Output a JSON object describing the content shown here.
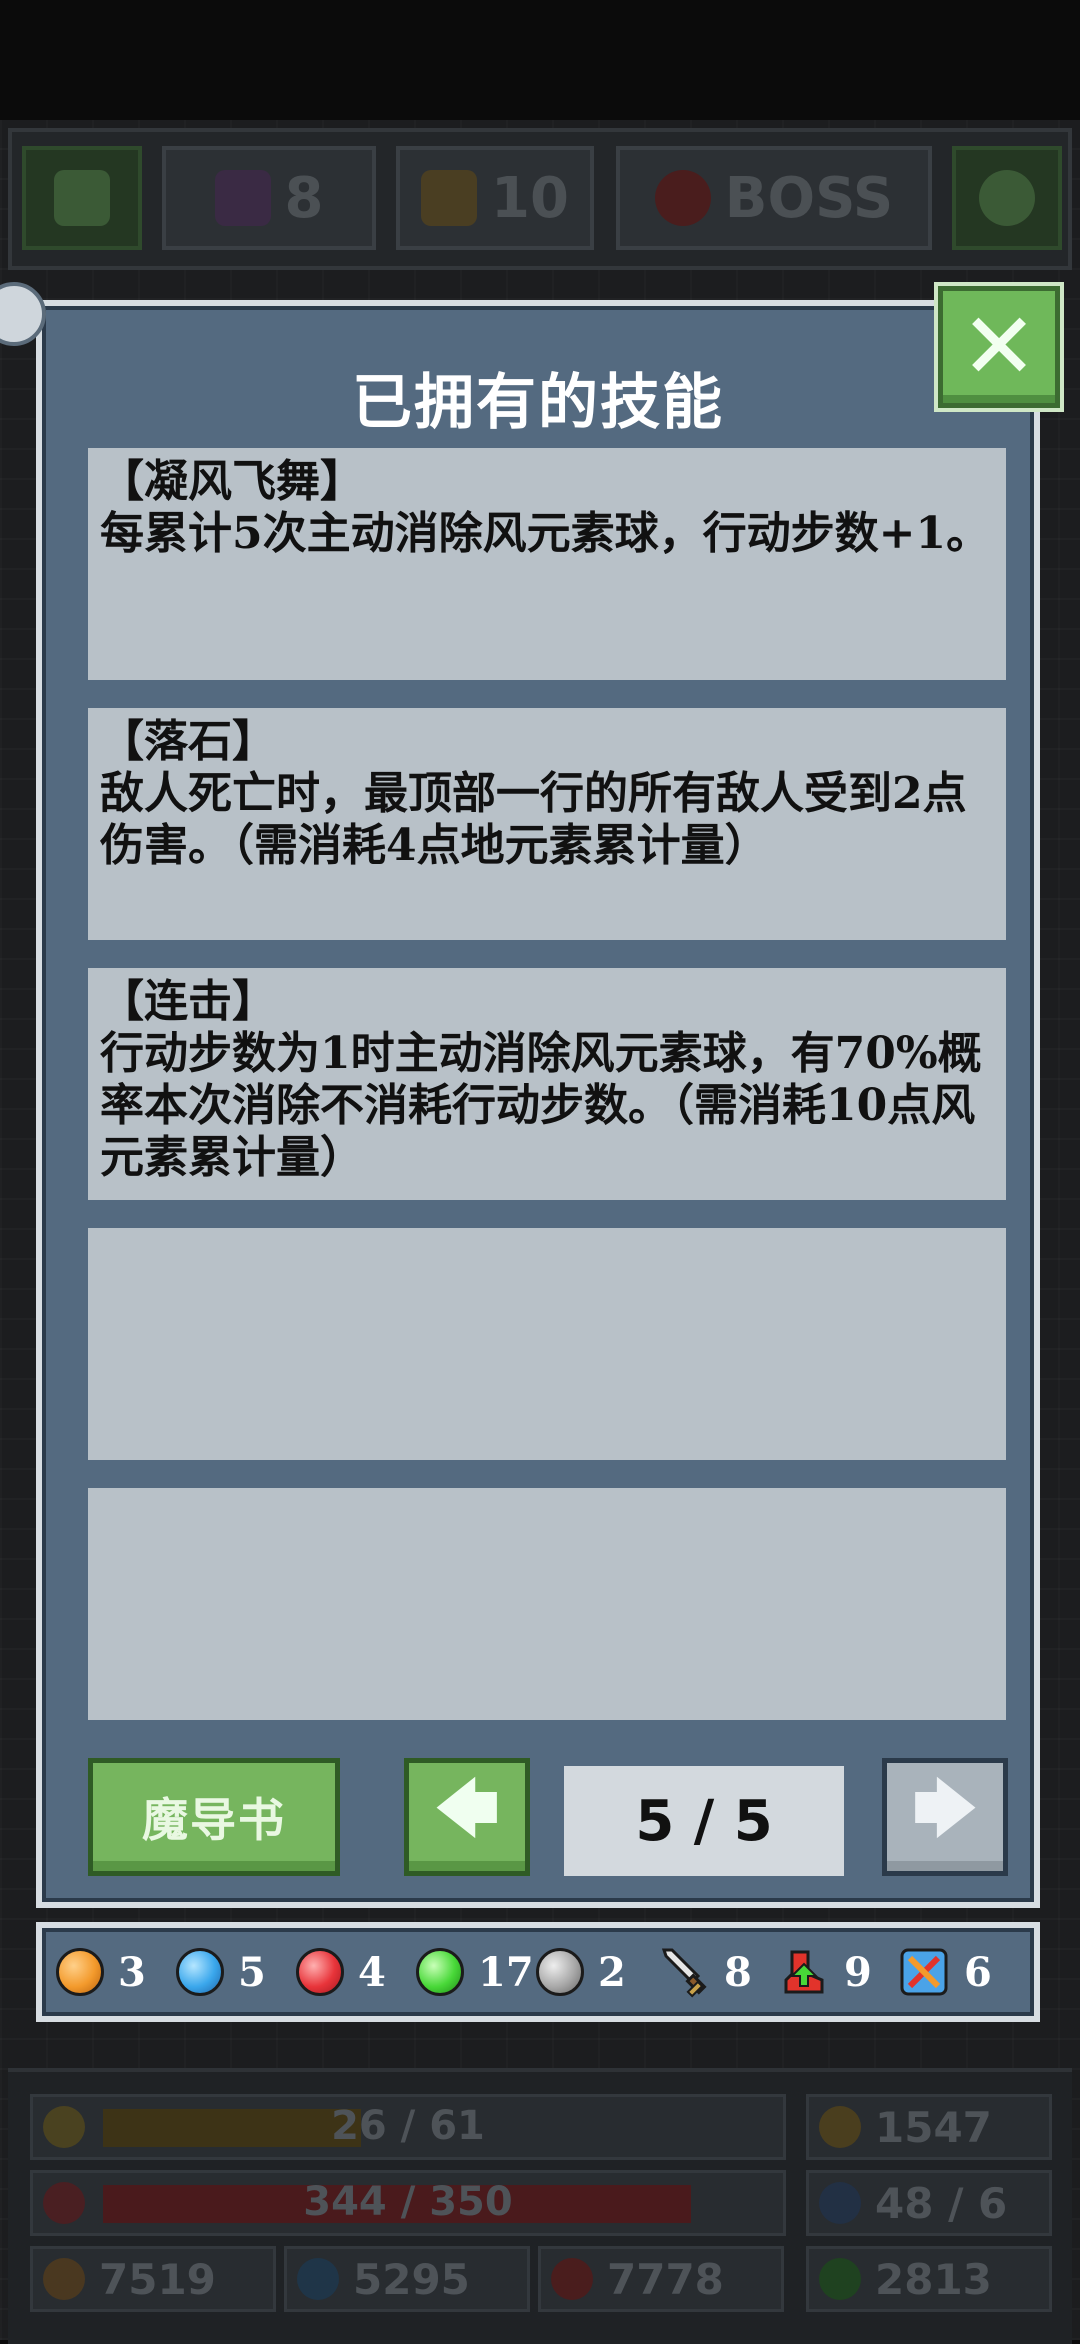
{
  "topbar": {
    "gems_value": "8",
    "level_value": "10",
    "boss_label": "BOSS"
  },
  "dialog": {
    "title": "已拥有的技能",
    "close_icon": "close-icon",
    "skills": [
      {
        "name": "【凝风飞舞】",
        "desc": "每累计5次主动消除风元素球，行动步数+1。"
      },
      {
        "name": "【落石】",
        "desc": "敌人死亡时，最顶部一行的所有敌人受到2点伤害。（需消耗4点地元素累计量）"
      },
      {
        "name": "【连击】",
        "desc": "行动步数为1时主动消除风元素球，有70%概率本次消除不消耗行动步数。（需消耗10点风元素累计量）"
      },
      {
        "name": "",
        "desc": ""
      },
      {
        "name": "",
        "desc": ""
      }
    ],
    "book_button": "魔导书",
    "page_indicator": "5 / 5",
    "prev_arrow": "🡄",
    "next_arrow": "🡆"
  },
  "resources": [
    {
      "icon": "orange-orb-icon",
      "color": "#f39a2c",
      "value": "3"
    },
    {
      "icon": "blue-orb-icon",
      "color": "#3aa7ec",
      "value": "5"
    },
    {
      "icon": "red-orb-icon",
      "color": "#e8343a",
      "value": "4"
    },
    {
      "icon": "green-orb-icon",
      "color": "#48d838",
      "value": "17"
    },
    {
      "icon": "gray-orb-icon",
      "color": "#a8a8a8",
      "value": "2"
    },
    {
      "icon": "sword-icon",
      "color": "#e6e6e6",
      "value": "8"
    },
    {
      "icon": "boot-icon",
      "color": "#e2332b",
      "value": "9"
    },
    {
      "icon": "crossed-weapons-icon",
      "color": "#4aa3e8",
      "value": "6"
    }
  ],
  "hud": {
    "xp_text": "26 / 61",
    "xp_fraction": 0.43,
    "hp_text": "344 / 350",
    "hp_fraction": 0.98,
    "gold": "1547",
    "moves": "48 / 6",
    "stat1": "7519",
    "stat2": "5295",
    "stat3": "7778",
    "stat4": "2813"
  }
}
